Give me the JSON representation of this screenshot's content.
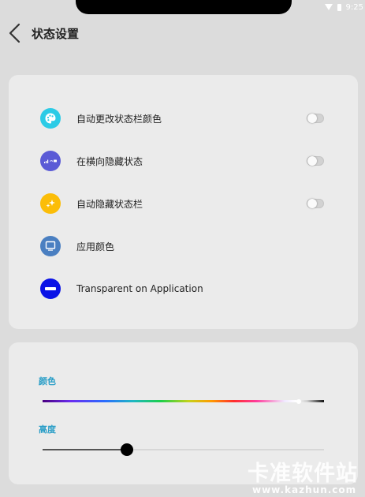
{
  "status_bar": {
    "time": "9:25"
  },
  "header": {
    "title": "状态设置"
  },
  "settings": [
    {
      "label": "自动更改状态栏颜色",
      "icon": "palette-icon",
      "icon_color": "#2ccbe6",
      "has_toggle": true,
      "toggle_on": false
    },
    {
      "label": "在横向隐藏状态",
      "icon": "status-bar-icon",
      "icon_color": "#5b5bd6",
      "has_toggle": true,
      "toggle_on": false
    },
    {
      "label": "自动隐藏状态栏",
      "icon": "sparkle-icon",
      "icon_color": "#fbbd08",
      "has_toggle": true,
      "toggle_on": false
    },
    {
      "label": "应用颜色",
      "icon": "monitor-icon",
      "icon_color": "#4a7fc1",
      "has_toggle": false
    },
    {
      "label": "Transparent on Application",
      "icon": "minus-circle-icon",
      "icon_color": "#0a12e6",
      "has_toggle": false
    }
  ],
  "color_section": {
    "label": "颜色",
    "selected_position": 0.91
  },
  "height_section": {
    "label": "高度",
    "value_fraction": 0.3
  },
  "watermark": {
    "title": "卡准软件站",
    "url": "www.kazhun.com"
  }
}
